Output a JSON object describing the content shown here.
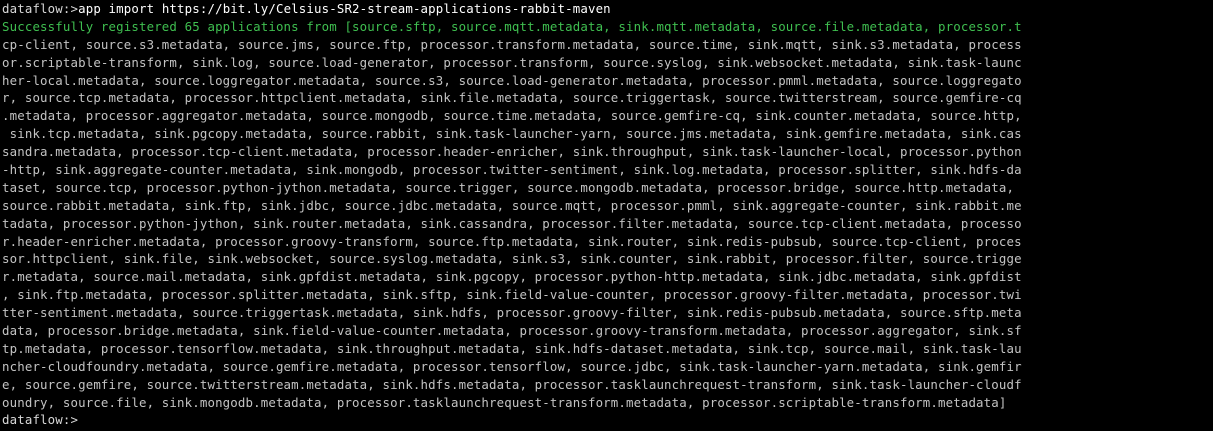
{
  "terminal": {
    "colors": {
      "background": "#000000",
      "text": "#c3c3c3",
      "success": "#3fbf50",
      "command": "#ffffff"
    },
    "first_prompt": "dataflow:>",
    "first_command": "app import https://bit.ly/Celsius-SR2-stream-applications-rabbit-maven",
    "output_lines": [
      "Successfully registered 65 applications from [source.sftp, source.mqtt.metadata, sink.mqtt.metadata, source.file.metadata, processor.t",
      "cp-client, source.s3.metadata, source.jms, source.ftp, processor.transform.metadata, source.time, sink.mqtt, sink.s3.metadata, process",
      "or.scriptable-transform, sink.log, source.load-generator, processor.transform, source.syslog, sink.websocket.metadata, sink.task-launc",
      "her-local.metadata, source.loggregator.metadata, source.s3, source.load-generator.metadata, processor.pmml.metadata, source.loggregato",
      "r, source.tcp.metadata, processor.httpclient.metadata, sink.file.metadata, source.triggertask, source.twitterstream, source.gemfire-cq",
      ".metadata, processor.aggregator.metadata, source.mongodb, source.time.metadata, source.gemfire-cq, sink.counter.metadata, source.http,",
      " sink.tcp.metadata, sink.pgcopy.metadata, source.rabbit, sink.task-launcher-yarn, source.jms.metadata, sink.gemfire.metadata, sink.cas",
      "sandra.metadata, processor.tcp-client.metadata, processor.header-enricher, sink.throughput, sink.task-launcher-local, processor.python",
      "-http, sink.aggregate-counter.metadata, sink.mongodb, processor.twitter-sentiment, sink.log.metadata, processor.splitter, sink.hdfs-da",
      "taset, source.tcp, processor.python-jython.metadata, source.trigger, source.mongodb.metadata, processor.bridge, source.http.metadata,",
      "source.rabbit.metadata, sink.ftp, sink.jdbc, source.jdbc.metadata, source.mqtt, processor.pmml, sink.aggregate-counter, sink.rabbit.me",
      "tadata, processor.python-jython, sink.router.metadata, sink.cassandra, processor.filter.metadata, source.tcp-client.metadata, processo",
      "r.header-enricher.metadata, processor.groovy-transform, source.ftp.metadata, sink.router, sink.redis-pubsub, source.tcp-client, proces",
      "sor.httpclient, sink.file, sink.websocket, source.syslog.metadata, sink.s3, sink.counter, sink.rabbit, processor.filter, source.trigge",
      "r.metadata, source.mail.metadata, sink.gpfdist.metadata, sink.pgcopy, processor.python-http.metadata, sink.jdbc.metadata, sink.gpfdist",
      ", sink.ftp.metadata, processor.splitter.metadata, sink.sftp, sink.field-value-counter, processor.groovy-filter.metadata, processor.twi",
      "tter-sentiment.metadata, source.triggertask.metadata, sink.hdfs, processor.groovy-filter, sink.redis-pubsub.metadata, source.sftp.meta",
      "data, processor.bridge.metadata, sink.field-value-counter.metadata, processor.groovy-transform.metadata, processor.aggregator, sink.sf",
      "tp.metadata, processor.tensorflow.metadata, sink.throughput.metadata, sink.hdfs-dataset.metadata, sink.tcp, source.mail, sink.task-lau",
      "ncher-cloudfoundry.metadata, source.gemfire.metadata, processor.tensorflow, source.jdbc, sink.task-launcher-yarn.metadata, sink.gemfir",
      "e, source.gemfire, source.twitterstream.metadata, sink.hdfs.metadata, processor.tasklaunchrequest-transform, sink.task-launcher-cloudf",
      "oundry, source.file, sink.mongodb.metadata, processor.tasklaunchrequest-transform.metadata, processor.scriptable-transform.metadata]"
    ],
    "second_prompt": "dataflow:>",
    "second_command": ""
  }
}
